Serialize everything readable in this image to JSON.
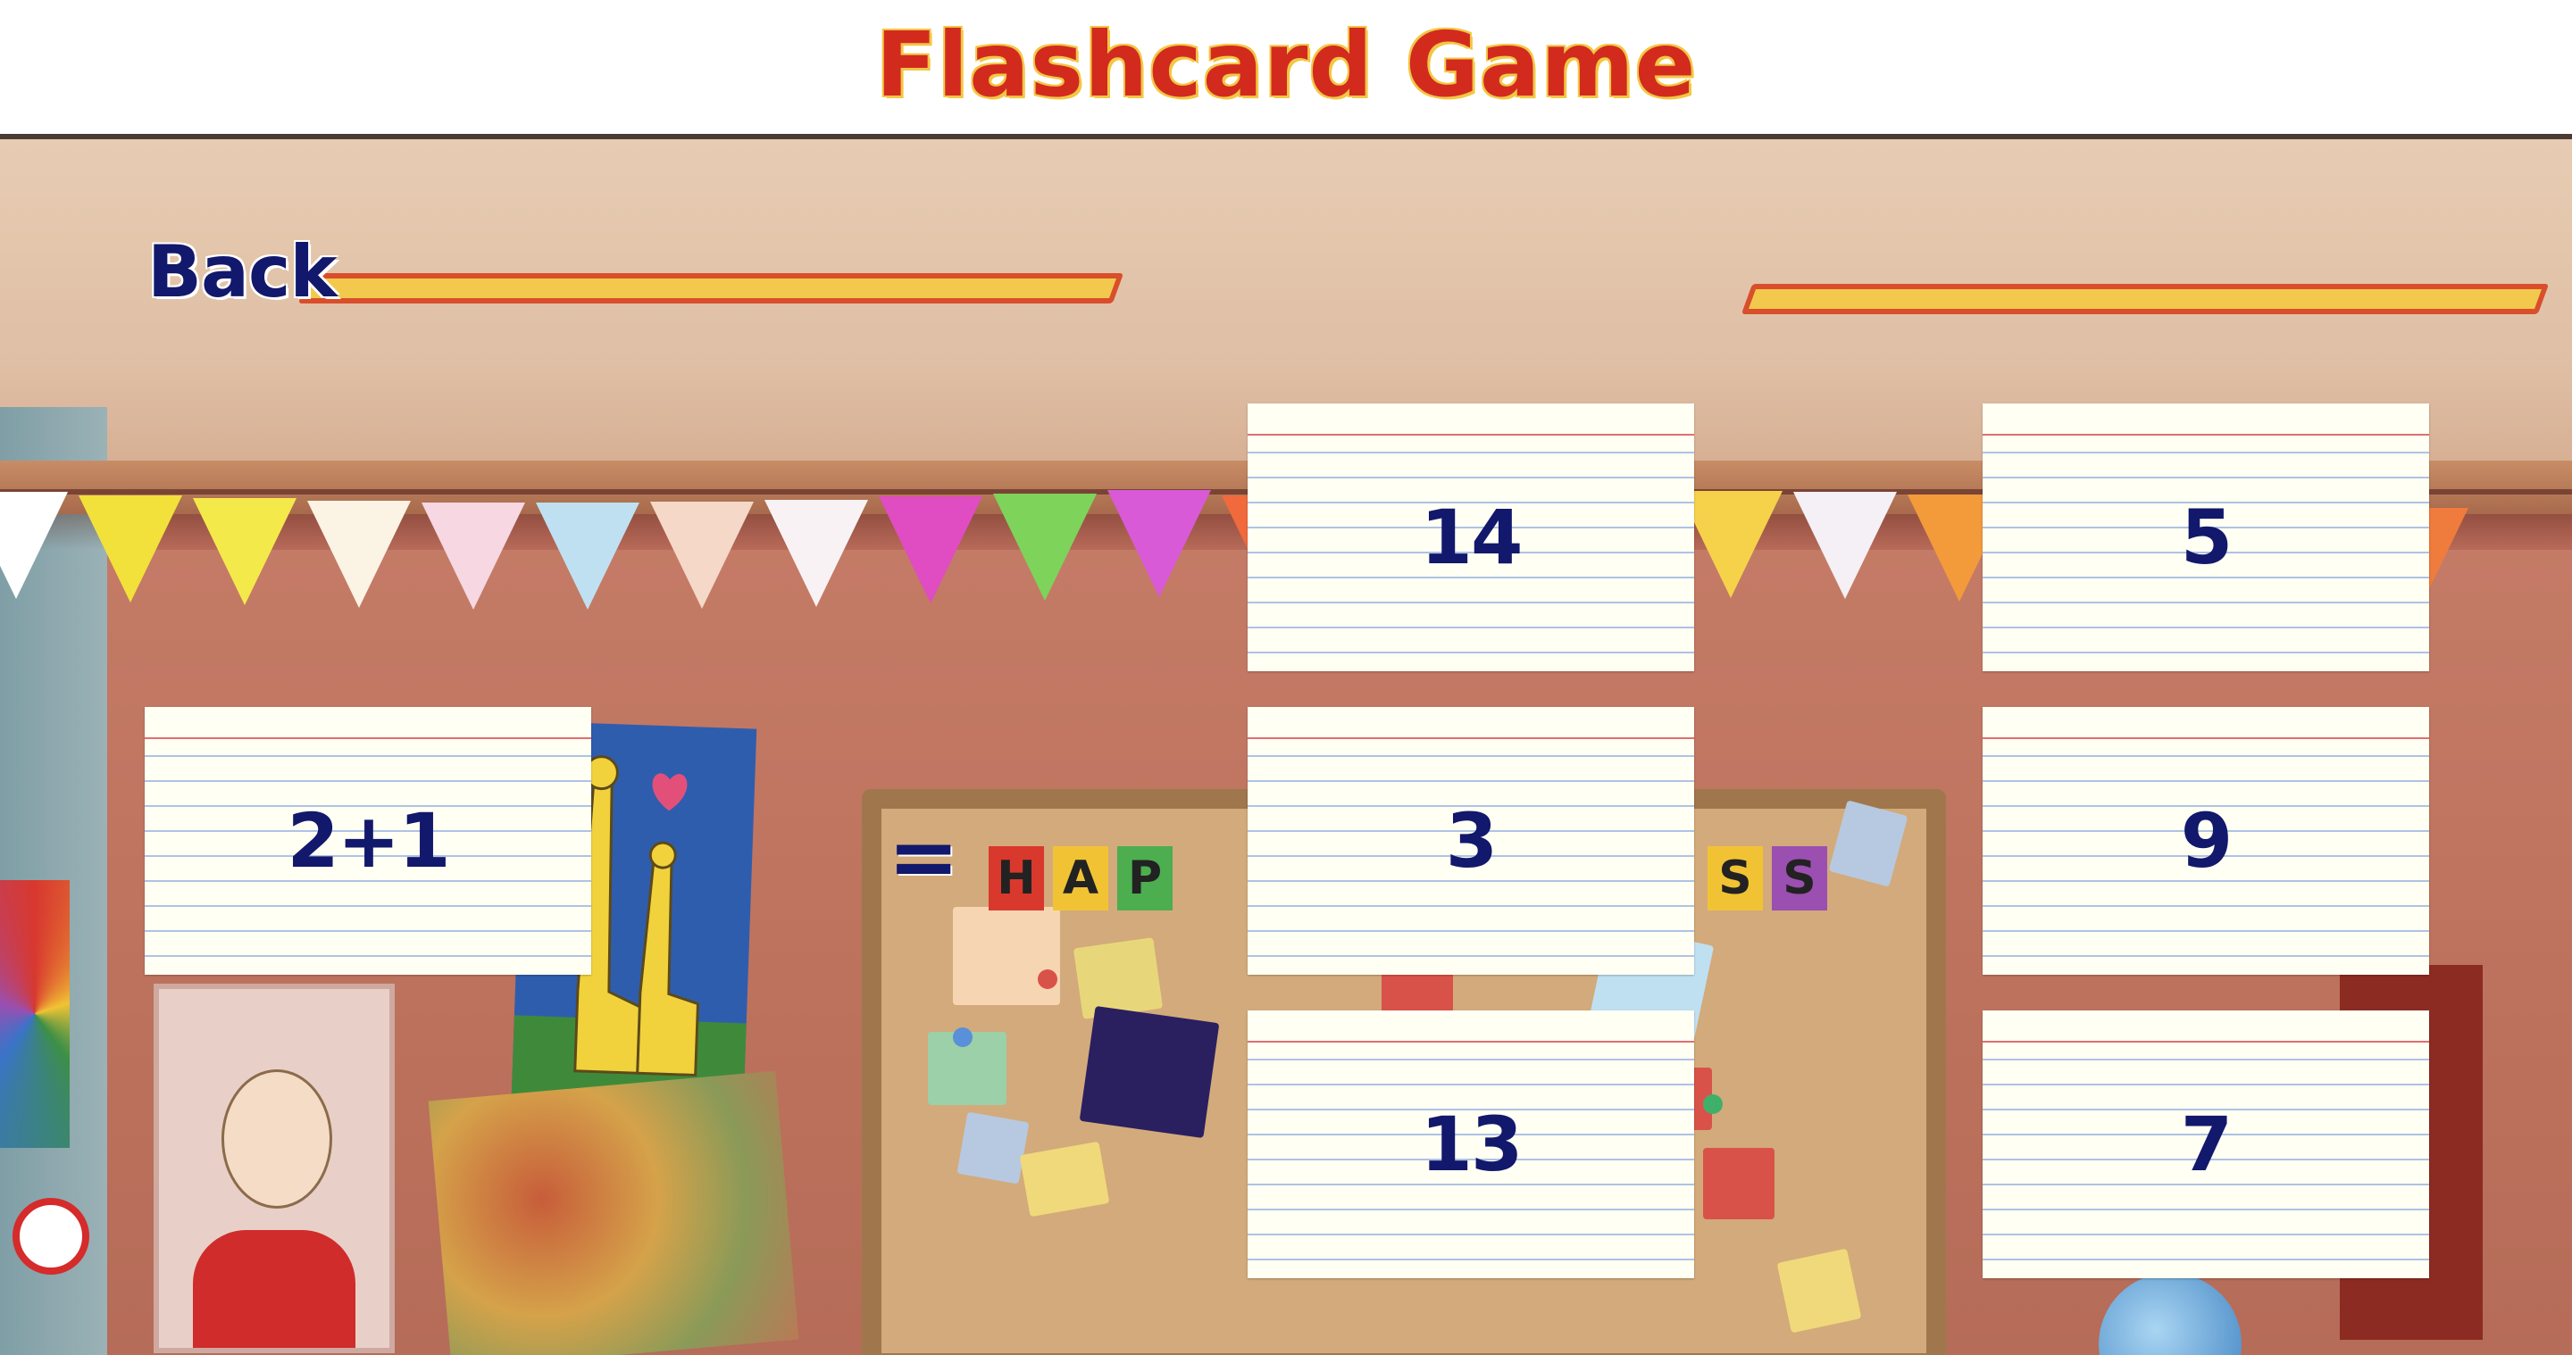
{
  "header": {
    "title": "Flashcard Game"
  },
  "controls": {
    "back_label": "Back"
  },
  "question": {
    "expression": "2+1",
    "equals": "="
  },
  "answers": [
    "14",
    "5",
    "3",
    "9",
    "13",
    "7"
  ],
  "scene": {
    "bunting_colors": [
      "#ffffff",
      "#f2e03b",
      "#f4e94a",
      "#fbf3e4",
      "#f6d7e2",
      "#bfe0f0",
      "#f5d8c7",
      "#f9f2f5",
      "#e04cc1",
      "#7ed35a",
      "#d85ad6",
      "#f06a3d",
      "#e9e0f2",
      "#b9dcf2",
      "#f3d4c3",
      "#f5d24a",
      "#f5f0f5",
      "#f39a3b",
      "#f8f2ee",
      "#f0e06a",
      "#9fd9e0",
      "#ef7b3d"
    ],
    "banner_letters": [
      "H",
      "A",
      "P",
      "S",
      "S"
    ]
  },
  "colors": {
    "title": "#d32a1e",
    "title_outline": "#f2c744",
    "text": "#12186b",
    "card_bg": "#fffff3"
  }
}
